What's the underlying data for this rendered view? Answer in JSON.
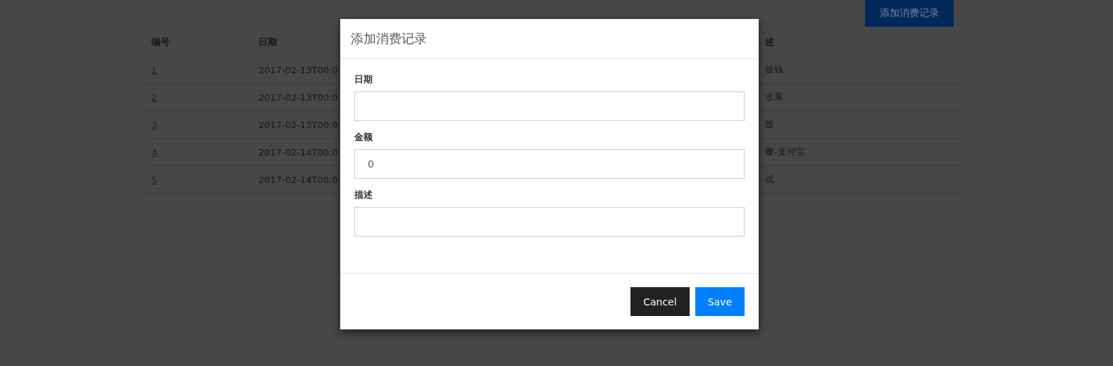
{
  "page": {
    "add_button": "添加消费记录"
  },
  "table": {
    "columns": [
      "编号",
      "日期",
      "述"
    ],
    "rows": [
      {
        "id": "1",
        "date": "2017-02-13T00:0",
        "description": "饭钱"
      },
      {
        "id": "2",
        "date": "2017-02-13T00:0",
        "description": "水果"
      },
      {
        "id": "3",
        "date": "2017-02-13T00:0",
        "description": "饭"
      },
      {
        "id": "4",
        "date": "2017-02-14T00:0",
        "description": "餐-支付宝"
      },
      {
        "id": "5",
        "date": "2017-02-14T00:0",
        "description": "试"
      }
    ]
  },
  "dialog": {
    "title": "添加消费记录",
    "fields": [
      {
        "label": "日期"
      },
      {
        "label": "金额",
        "value": "0"
      },
      {
        "label": "描述"
      }
    ],
    "buttons": [
      {
        "label": "Cancel",
        "kind": "secondary"
      },
      {
        "label": "Save",
        "kind": "primary"
      }
    ]
  }
}
